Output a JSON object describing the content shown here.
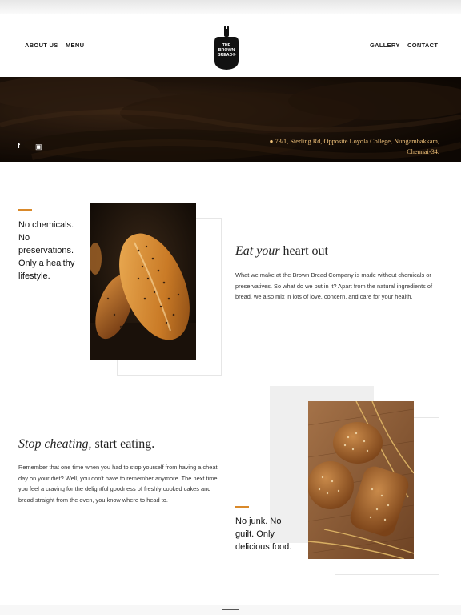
{
  "nav": {
    "about": "ABOUT US",
    "menu": "MENU",
    "gallery": "GALLERY",
    "contact": "CONTACT"
  },
  "logo": {
    "line1": "THE",
    "line2": "BROWN",
    "line3": "BREAD®"
  },
  "hero": {
    "address_line1": "● 73/1, Sterling Rd, Opposite Loyola College, Nungambakkam,",
    "address_line2": "Chennai-34.",
    "facebook_glyph": "f",
    "instagram_glyph": "▣"
  },
  "section1": {
    "tagline": [
      "No chemicals.",
      "No",
      "preservations.",
      "Only a healthy",
      "lifestyle."
    ],
    "title_italic": "Eat your",
    "title_rest": " heart out",
    "body": "What we make at the Brown Bread Company is made without chemicals or preservatives. So what do we put in it? Apart from the natural ingredients of bread, we also mix in lots of love, concern, and care for your health."
  },
  "section2": {
    "title_italic": "Stop cheating,",
    "title_rest": " start eating.",
    "body": "Remember that one time when you had to stop yourself from having a cheat day on your diet? Well, you don't have to remember anymore. The next time you feel a craving for the delightful goodness of freshly cooked cakes and bread straight from the oven, you know where to head to.",
    "tagline": [
      "No junk. No",
      "guilt. Only",
      "delicious food."
    ]
  },
  "colors": {
    "accent": "#d9892a",
    "address": "#f0c27a"
  }
}
